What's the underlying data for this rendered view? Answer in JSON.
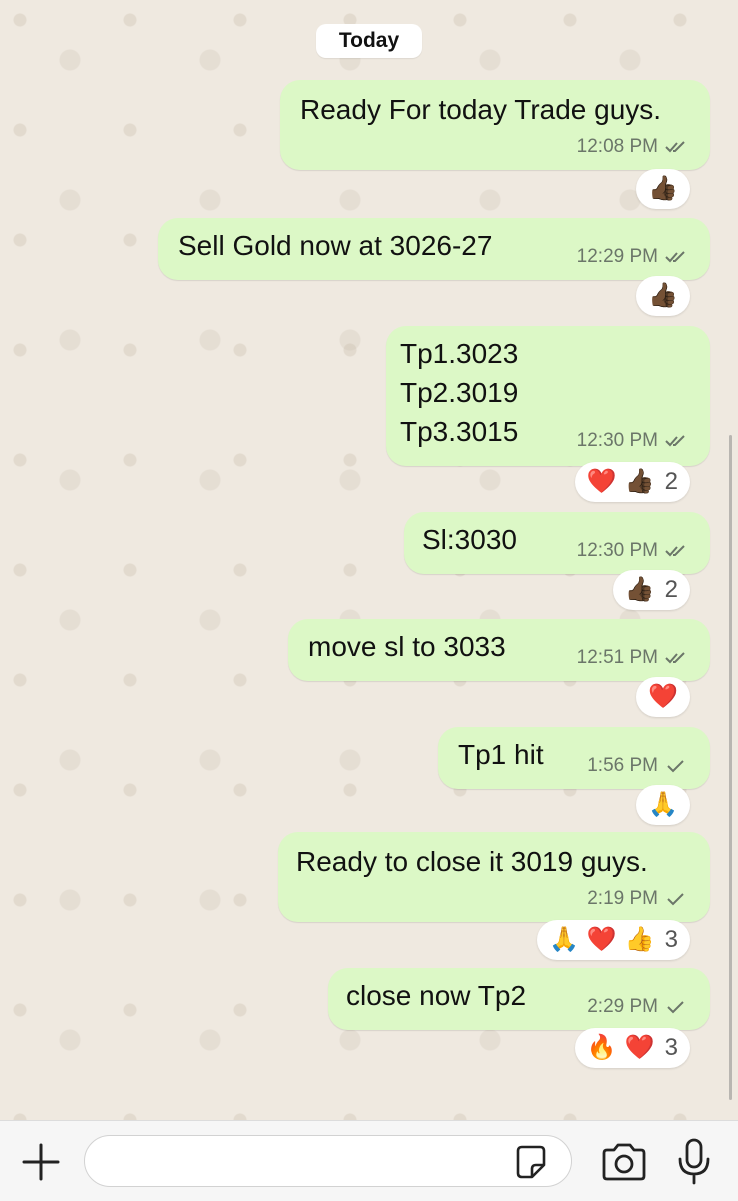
{
  "date_divider": "Today",
  "messages": [
    {
      "text": "Ready For today Trade guys.",
      "time": "12:08 PM",
      "status": "read",
      "reactions": [
        {
          "emoji": "👍🏾"
        }
      ],
      "count": ""
    },
    {
      "text": "Sell Gold now at 3026-27",
      "time": "12:29 PM",
      "status": "read",
      "reactions": [
        {
          "emoji": "👍🏾"
        }
      ],
      "count": ""
    },
    {
      "text": "Tp1.3023\nTp2.3019\nTp3.3015",
      "time": "12:30 PM",
      "status": "read",
      "reactions": [
        {
          "emoji": "❤️"
        },
        {
          "emoji": "👍🏾"
        }
      ],
      "count": "2"
    },
    {
      "text": "Sl:3030",
      "time": "12:30 PM",
      "status": "read",
      "reactions": [
        {
          "emoji": "👍🏾"
        }
      ],
      "count": "2"
    },
    {
      "text": "move sl to 3033",
      "time": "12:51 PM",
      "status": "read",
      "reactions": [
        {
          "emoji": "❤️"
        }
      ],
      "count": ""
    },
    {
      "text": "Tp1 hit",
      "time": "1:56 PM",
      "status": "sent",
      "reactions": [
        {
          "emoji": "🙏"
        }
      ],
      "count": ""
    },
    {
      "text": "Ready to close it 3019 guys.",
      "time": "2:19 PM",
      "status": "sent",
      "reactions": [
        {
          "emoji": "🙏"
        },
        {
          "emoji": "❤️"
        },
        {
          "emoji": "👍"
        }
      ],
      "count": "3"
    },
    {
      "text": "close now Tp2",
      "time": "2:29 PM",
      "status": "sent",
      "reactions": [
        {
          "emoji": "🔥"
        },
        {
          "emoji": "❤️"
        }
      ],
      "count": "3"
    }
  ],
  "composer": {
    "icons": [
      "plus-icon",
      "sticker-icon",
      "camera-icon",
      "microphone-icon"
    ],
    "placeholder": ""
  },
  "colors": {
    "outgoing_bubble": "#dcf8c6",
    "chat_background": "#efe9e0",
    "tick_read": "#6b7669"
  }
}
